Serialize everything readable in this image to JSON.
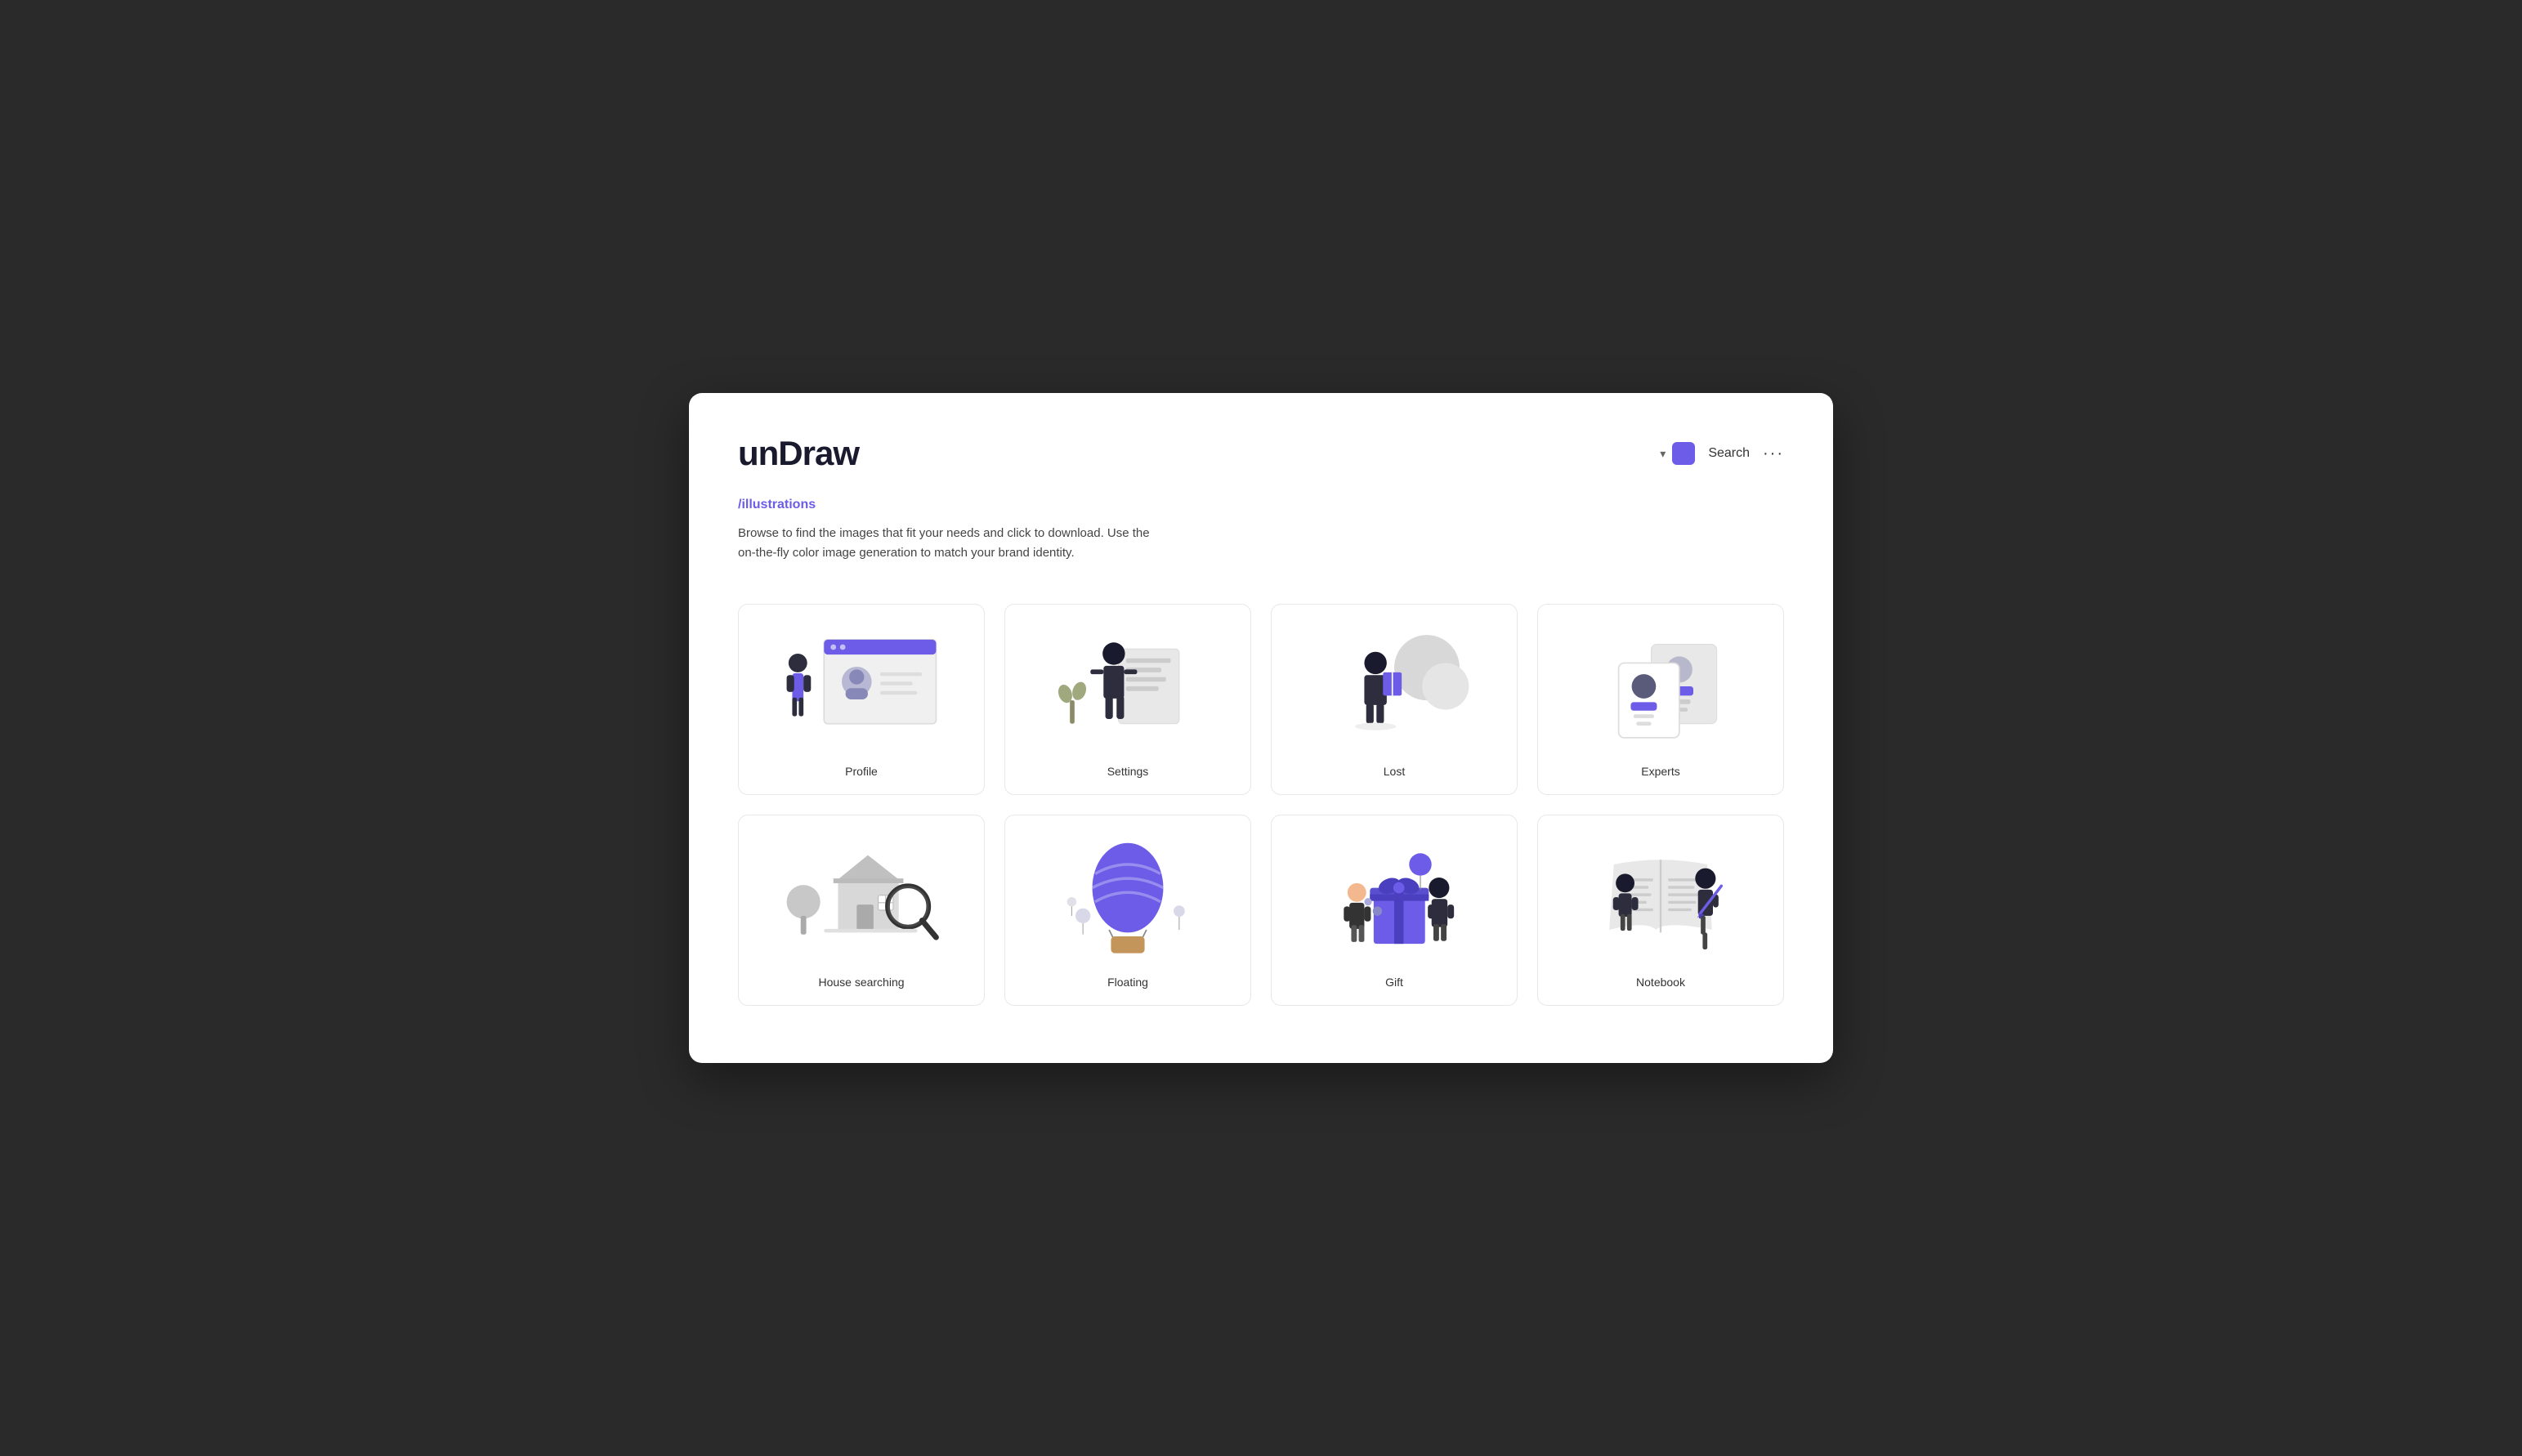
{
  "header": {
    "logo": "unDraw",
    "color_swatch": "#6c5ce7",
    "search_label": "Search",
    "more_icon": "···"
  },
  "breadcrumb": "/illustrations",
  "description": "Browse to find the images that fit your needs and click to download. Use the on-the-fly color image generation to match your brand identity.",
  "cards": [
    {
      "id": "profile",
      "label": "Profile",
      "row": 1
    },
    {
      "id": "settings",
      "label": "Settings",
      "row": 1
    },
    {
      "id": "lost",
      "label": "Lost",
      "row": 1
    },
    {
      "id": "experts",
      "label": "Experts",
      "row": 1
    },
    {
      "id": "house-searching",
      "label": "House searching",
      "row": 2
    },
    {
      "id": "floating",
      "label": "Floating",
      "row": 2
    },
    {
      "id": "gift",
      "label": "Gift",
      "row": 2
    },
    {
      "id": "notebook",
      "label": "Notebook",
      "row": 2
    }
  ]
}
